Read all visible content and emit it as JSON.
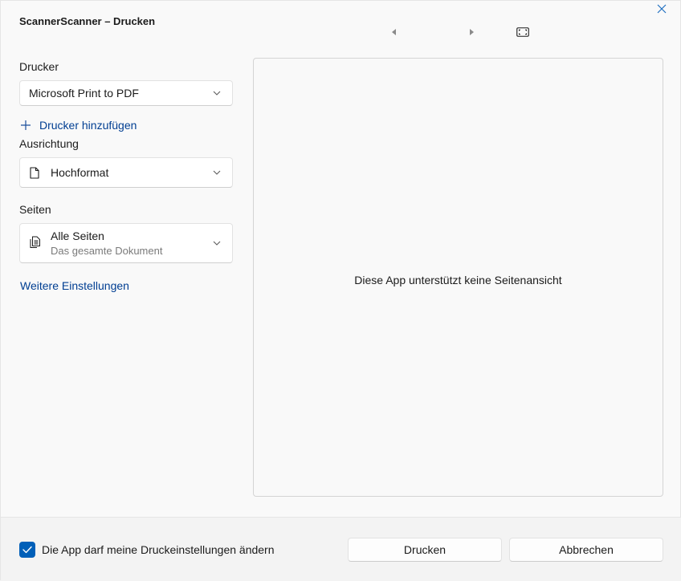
{
  "window": {
    "title": "ScannerScanner – Drucken"
  },
  "printer": {
    "label": "Drucker",
    "selected": "Microsoft Print to PDF",
    "add_link": "Drucker hinzufügen"
  },
  "orientation": {
    "label": "Ausrichtung",
    "selected": "Hochformat"
  },
  "pages": {
    "label": "Seiten",
    "selected": "Alle Seiten",
    "selected_sub": "Das gesamte Dokument"
  },
  "more_settings_link": "Weitere Einstellungen",
  "preview": {
    "message": "Diese App unterstützt keine Seitenansicht"
  },
  "footer": {
    "checkbox_label": "Die App darf meine Druckeinstellungen ändern",
    "checkbox_checked": true,
    "print_button": "Drucken",
    "cancel_button": "Abbrechen"
  },
  "icons": {
    "close": "close-icon",
    "prev": "prev-page-icon",
    "next": "next-page-icon",
    "fit": "fit-page-icon",
    "plus": "plus-icon",
    "document": "document-icon",
    "pages": "pages-icon",
    "chevron": "chevron-down-icon",
    "check": "checkmark-icon"
  },
  "colors": {
    "accent": "#005fb8",
    "link": "#003e92"
  }
}
